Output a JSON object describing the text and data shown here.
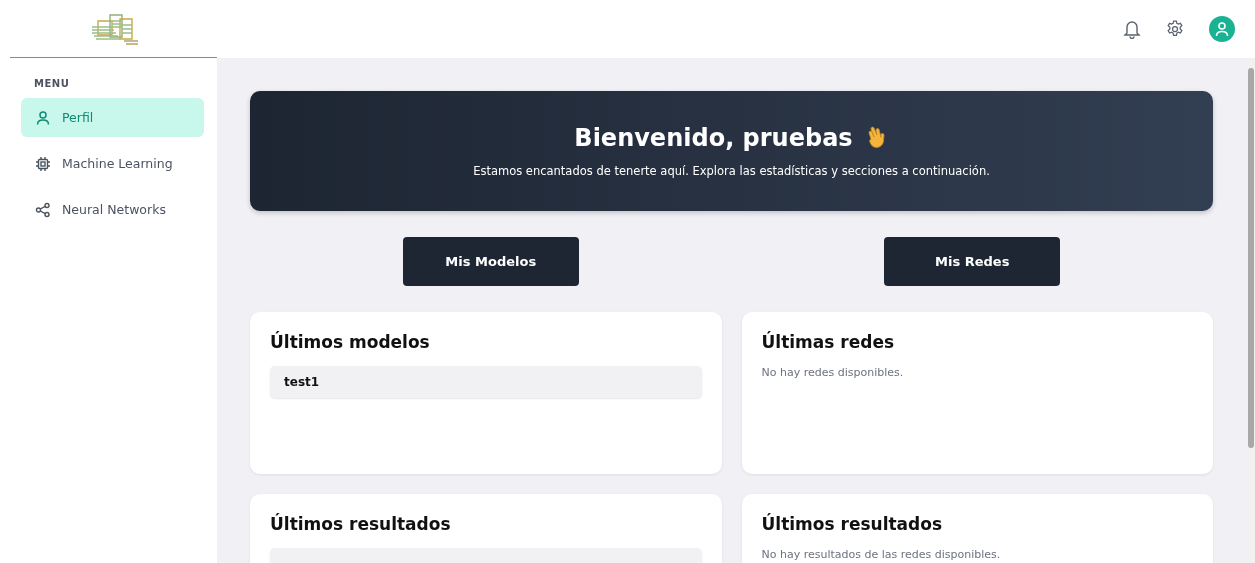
{
  "sidebar": {
    "section_label": "MENU",
    "items": [
      {
        "label": "Perfil",
        "selected": true
      },
      {
        "label": "Machine Learning",
        "selected": false
      },
      {
        "label": "Neural Networks",
        "selected": false
      }
    ]
  },
  "welcome": {
    "title": "Bienvenido, pruebas",
    "subtitle": "Estamos encantados de tenerte aquí. Explora las estadísticas y secciones a continuación."
  },
  "buttons": [
    "Mis Modelos",
    "Mis Redes"
  ],
  "cards": [
    {
      "title": "Últimos modelos",
      "items": [
        "test1"
      ]
    },
    {
      "title": "Últimas redes",
      "empty_text": "No hay redes disponibles."
    },
    {
      "title": "Últimos resultados",
      "kind": "loading"
    },
    {
      "title": "Últimos resultados",
      "empty_text": "No hay resultados de las redes disponibles."
    }
  ]
}
